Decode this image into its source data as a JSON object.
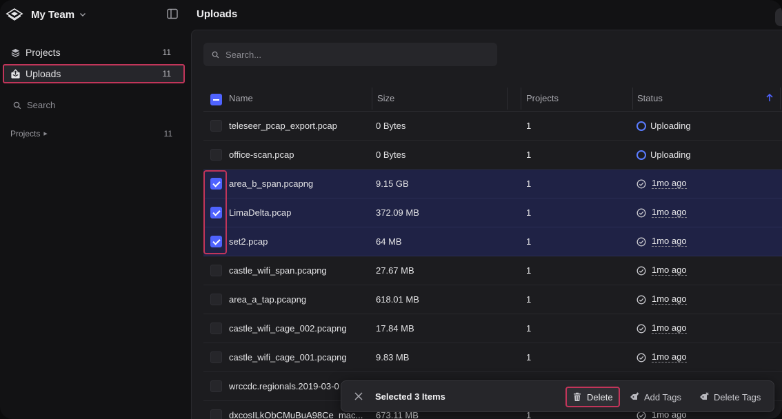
{
  "app": {
    "team_name": "My Team",
    "page_title": "Uploads"
  },
  "sidebar": {
    "items": [
      {
        "label": "Projects",
        "count": "11",
        "icon": "layers-icon"
      },
      {
        "label": "Uploads",
        "count": "11",
        "icon": "upload-tray-icon",
        "active": true
      }
    ],
    "search_label": "Search",
    "section": {
      "label": "Projects",
      "count": "11"
    }
  },
  "search": {
    "placeholder": "Search..."
  },
  "table": {
    "columns": [
      "Name",
      "Size",
      "Projects",
      "Status"
    ],
    "sort": {
      "column": "Status",
      "direction": "ascending"
    },
    "rows": [
      {
        "name": "teleseer_pcap_export.pcap",
        "size": "0 Bytes",
        "projects": "1",
        "status": "Uploading",
        "selected": false
      },
      {
        "name": "office-scan.pcap",
        "size": "0 Bytes",
        "projects": "1",
        "status": "Uploading",
        "selected": false
      },
      {
        "name": "area_b_span.pcapng",
        "size": "9.15 GB",
        "projects": "1",
        "status": "1mo ago",
        "selected": true
      },
      {
        "name": "LimaDelta.pcap",
        "size": "372.09 MB",
        "projects": "1",
        "status": "1mo ago",
        "selected": true
      },
      {
        "name": "set2.pcap",
        "size": "64 MB",
        "projects": "1",
        "status": "1mo ago",
        "selected": true
      },
      {
        "name": "castle_wifi_span.pcapng",
        "size": "27.67 MB",
        "projects": "1",
        "status": "1mo ago",
        "selected": false
      },
      {
        "name": "area_a_tap.pcapng",
        "size": "618.01 MB",
        "projects": "1",
        "status": "1mo ago",
        "selected": false
      },
      {
        "name": "castle_wifi_cage_002.pcapng",
        "size": "17.84 MB",
        "projects": "1",
        "status": "1mo ago",
        "selected": false
      },
      {
        "name": "castle_wifi_cage_001.pcapng",
        "size": "9.83 MB",
        "projects": "1",
        "status": "1mo ago",
        "selected": false
      },
      {
        "name": "wrccdc.regionals.2019-03-0",
        "size": "",
        "projects": "",
        "status": "",
        "selected": false
      },
      {
        "name": "dxcosILkObCMuBuA98Ce_mac...",
        "size": "673.11 MB",
        "projects": "1",
        "status": "1mo ago",
        "selected": false
      }
    ]
  },
  "action_bar": {
    "title": "Selected 3 Items",
    "delete_label": "Delete",
    "add_tags_label": "Add Tags",
    "delete_tags_label": "Delete Tags"
  },
  "colors": {
    "accent": "#4f63ff",
    "highlight": "#c2355a",
    "selected_row": "#1f2245"
  }
}
